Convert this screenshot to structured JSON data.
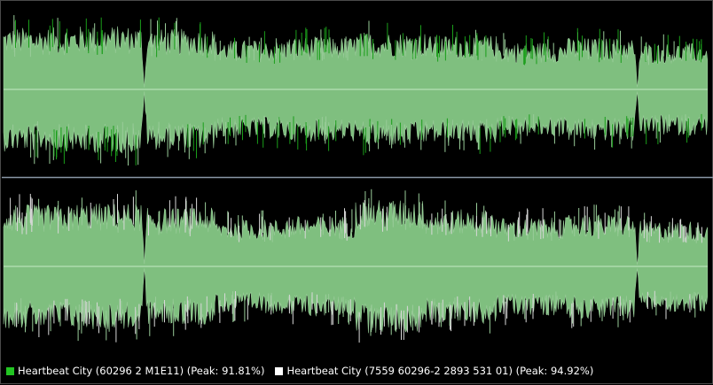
{
  "colors": {
    "background": "#000000",
    "fill": "#7fbf7f",
    "fill_edge": "#99cc99",
    "peak_green": "#1a9e1a",
    "peak_white": "#d8d8d8",
    "baseline": "#c6e8c6",
    "divider": "#8a96a6"
  },
  "channels": [
    {
      "name": "top-channel",
      "peak_color_key": "peak_green",
      "segments": [
        {
          "amplitude": 0.78,
          "gap_before": false
        },
        {
          "amplitude": 0.8,
          "gap_before": false
        },
        {
          "amplitude": 0.76,
          "gap_before": true
        },
        {
          "amplitude": 0.62,
          "gap_before": false
        },
        {
          "amplitude": 0.66,
          "gap_before": false
        },
        {
          "amplitude": 0.72,
          "gap_before": false
        },
        {
          "amplitude": 0.68,
          "gap_before": false
        },
        {
          "amplitude": 0.6,
          "gap_before": false
        },
        {
          "amplitude": 0.65,
          "gap_before": false
        },
        {
          "amplitude": 0.58,
          "gap_before": true
        }
      ]
    },
    {
      "name": "bottom-channel",
      "peak_color_key": "peak_white",
      "segments": [
        {
          "amplitude": 0.76,
          "gap_before": false
        },
        {
          "amplitude": 0.78,
          "gap_before": false
        },
        {
          "amplitude": 0.72,
          "gap_before": true
        },
        {
          "amplitude": 0.58,
          "gap_before": false
        },
        {
          "amplitude": 0.62,
          "gap_before": false
        },
        {
          "amplitude": 0.82,
          "gap_before": false
        },
        {
          "amplitude": 0.7,
          "gap_before": false
        },
        {
          "amplitude": 0.6,
          "gap_before": false
        },
        {
          "amplitude": 0.64,
          "gap_before": false
        },
        {
          "amplitude": 0.56,
          "gap_before": true
        }
      ]
    }
  ],
  "legend": [
    {
      "label": "Heartbeat City (60296 2 M1E11) (Peak: 91.81%)",
      "color": "#22c522"
    },
    {
      "label": "Heartbeat City (7559 60296-2 2893 531 01) (Peak: 94.92%)",
      "color": "#ffffff"
    }
  ]
}
